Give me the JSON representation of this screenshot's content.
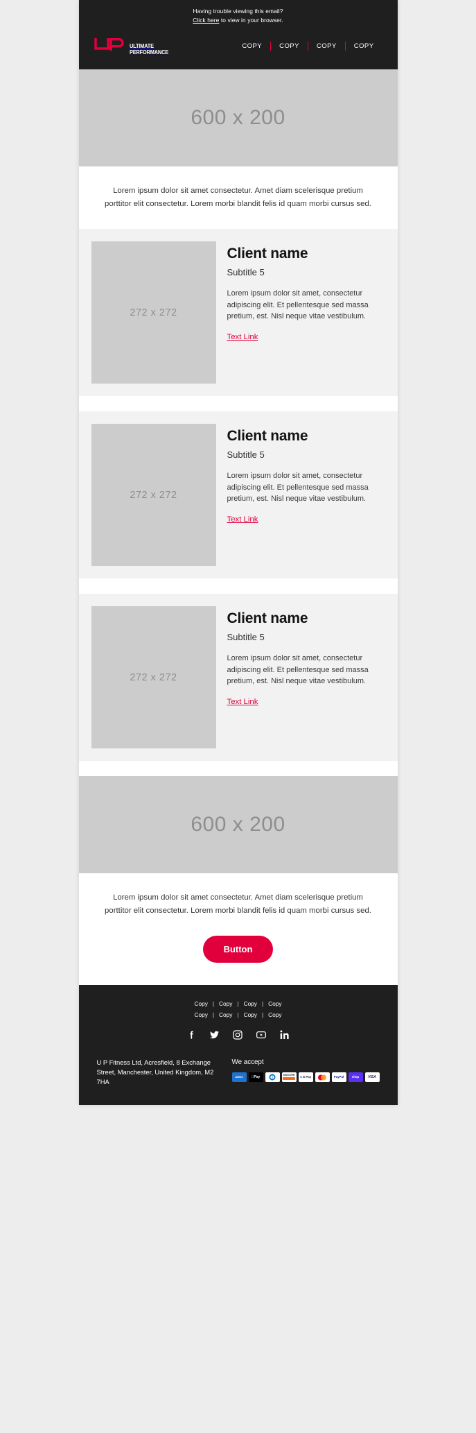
{
  "header": {
    "preheader_line1": "Having trouble viewing this email?",
    "preheader_link": "Click here",
    "preheader_line2": " to view in your browser.",
    "logo_line1": "ULTIMATE",
    "logo_line2": "PERFORMANCE",
    "nav": [
      {
        "label": "COPY"
      },
      {
        "label": "COPY"
      },
      {
        "label": "COPY"
      },
      {
        "label": "COPY"
      }
    ]
  },
  "hero_top": {
    "placeholder": "600 x 200"
  },
  "hero_bottom": {
    "placeholder": "600 x 200"
  },
  "intro": {
    "text": "Lorem ipsum dolor sit amet consectetur. Amet diam scelerisque pretium porttitor elit consectetur. Lorem morbi blandit felis id quam morbi cursus sed."
  },
  "outro": {
    "text": "Lorem ipsum dolor sit amet consectetur. Amet diam scelerisque pretium porttitor elit consectetur. Lorem morbi blandit felis id quam morbi cursus sed.",
    "button_label": "Button"
  },
  "cards": [
    {
      "image_placeholder": "272 x 272",
      "title": "Client name",
      "subtitle": "Subtitle 5",
      "body": "Lorem ipsum dolor sit amet, consectetur adipiscing elit. Et pellentesque sed massa pretium, est. Nisl neque vitae vestibulum.",
      "link": "Text Link"
    },
    {
      "image_placeholder": "272 x 272",
      "title": "Client name",
      "subtitle": "Subtitle 5",
      "body": "Lorem ipsum dolor sit amet, consectetur adipiscing elit. Et pellentesque sed massa pretium, est. Nisl neque vitae vestibulum.",
      "link": "Text Link"
    },
    {
      "image_placeholder": "272 x 272",
      "title": "Client name",
      "subtitle": "Subtitle 5",
      "body": "Lorem ipsum dolor sit amet, consectetur adipiscing elit. Et pellentesque sed massa pretium, est. Nisl neque vitae vestibulum.",
      "link": "Text Link"
    }
  ],
  "footer": {
    "links_row1": [
      "Copy",
      "Copy",
      "Copy",
      "Copy"
    ],
    "links_row2": [
      "Copy",
      "Copy",
      "Copy",
      "Copy"
    ],
    "separator": "|",
    "social": [
      "facebook-icon",
      "twitter-icon",
      "instagram-icon",
      "youtube-icon",
      "linkedin-icon"
    ],
    "address": "U P Fitness Ltd, Acresfield, 8 Exchange Street, Manchester, United Kingdom, M2 7HA",
    "we_accept_label": "We accept",
    "payments": [
      {
        "name": "amex",
        "text": "AMEX"
      },
      {
        "name": "apple-pay",
        "text": "Pay"
      },
      {
        "name": "diners-club",
        "text": "DC"
      },
      {
        "name": "discover",
        "text": "DISCOVER"
      },
      {
        "name": "google-pay",
        "text": "G Pay"
      },
      {
        "name": "mastercard",
        "text": "MC"
      },
      {
        "name": "paypal",
        "text": "PayPal"
      },
      {
        "name": "shop-pay",
        "text": "shop"
      },
      {
        "name": "visa",
        "text": "VISA"
      }
    ]
  },
  "colors": {
    "brand_red": "#e2003c",
    "dark": "#1f1f1f",
    "placeholder_grey": "#cccccc",
    "card_bg": "#f2f2f2",
    "page_bg": "#ededed"
  }
}
